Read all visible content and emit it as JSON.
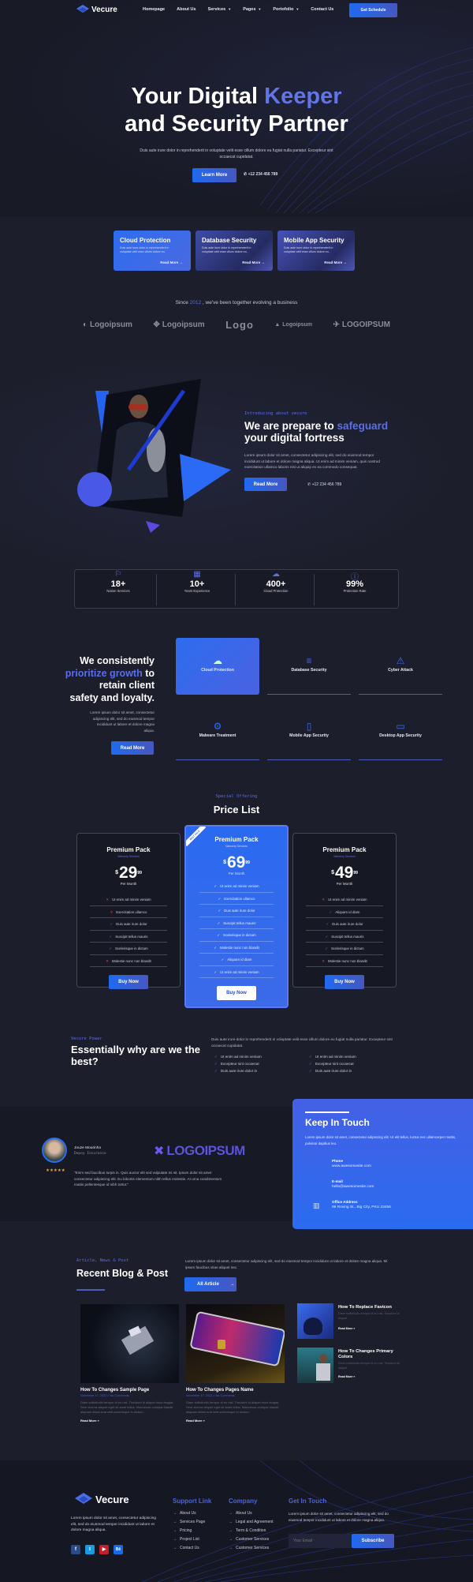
{
  "header": {
    "brand": "Vecure",
    "nav": [
      "Homepage",
      "About Us",
      "Services",
      "Pages",
      "Portofolio",
      "Contact Us"
    ],
    "nav_dropdown": [
      false,
      false,
      true,
      true,
      true,
      false
    ],
    "cta": "Get Schedule"
  },
  "hero": {
    "title_a": "Your Digital ",
    "title_accent": "Keeper",
    "title_b": "and Security Partner",
    "subtitle": "Duis aute irure dolor in reprehenderit in voluptate velit esse cillum dolore eu fugiat nulla pariatur. Excepteur sint occaecat cupidatat.",
    "button": "Learn More",
    "phone": "+12 234 456 789"
  },
  "feature_cards": [
    {
      "title": "Cloud Protection",
      "text": "Duis aute irure dolor in reprehenderit in voluptate velit esse cillum dolore eu.",
      "link": "Read More"
    },
    {
      "title": "Database Security",
      "text": "Duis aute irure dolor in reprehenderit in voluptate velit esse cillum dolore eu.",
      "link": "Read More"
    },
    {
      "title": "Mobile App Security",
      "text": "Duis aute irure dolor in reprehenderit in voluptate velit esse cillum dolore eu.",
      "link": "Read More"
    }
  ],
  "partners": {
    "tagline_a": "Since ",
    "year": "2012",
    "tagline_b": " , we've been together evolving a business",
    "logos": [
      "Logoipsum",
      "Logoipsum",
      "Logo",
      "Logoipsum",
      "LOGOIPSUM"
    ]
  },
  "about": {
    "eyebrow": "Introducing about vecure",
    "title_a": "We are prepare to ",
    "title_accent": "safeguard",
    "title_b": "your digital fortress",
    "text": "Lorem ipsum dolor sit amet, consectetur adipiscing elit, sed do eiusmod tempor incididunt ut labore et dolore magna aliqua. Ut enim ad minim veniam, quis nostrud exercitation ullamco laboris nisi ut aliquip ex ea commodo consequat.",
    "button": "Read More",
    "phone": "+12 234 456 789"
  },
  "stats": [
    {
      "icon": "flag-icon",
      "value": "18+",
      "label": "Nation Services"
    },
    {
      "icon": "calendar-icon",
      "value": "10+",
      "label": "Years Experience"
    },
    {
      "icon": "cloud-icon",
      "value": "400+",
      "label": "Cloud Protection"
    },
    {
      "icon": "alert-icon",
      "value": "99%",
      "label": "Protection Rate"
    }
  ],
  "growth": {
    "title_a": "We consistently",
    "title_accent": "prioritize growth",
    "title_b": " to",
    "title_c": "retain client",
    "title_d": "safety and loyalty.",
    "text": "Lorem ipsum dolor sit amet, consectetur adipiscing elit, sed do eiusmod tempor incididunt ut labore et dolore magna aliqua.",
    "button": "Read More",
    "services": [
      {
        "icon": "☁",
        "label": "Cloud Protection"
      },
      {
        "icon": "≡",
        "label": "Database Security"
      },
      {
        "icon": "⚠",
        "label": "Cyber Attack"
      },
      {
        "icon": "⚙",
        "label": "Malware Treatment"
      },
      {
        "icon": "▯",
        "label": "Mobile App Security"
      },
      {
        "icon": "▭",
        "label": "Desktop App Security"
      }
    ]
  },
  "pricing": {
    "eyebrow": "Special Offering",
    "title": "Price List",
    "ribbon": "BEST SALE",
    "plans": [
      {
        "name": "Premium Pack",
        "sub": "Warranty Services",
        "currency": "$",
        "price": "29",
        "cents": "99",
        "period": "Per Month",
        "button": "Buy Now",
        "features": [
          {
            "t": "Ut enim ad minim veniam",
            "ok": false
          },
          {
            "t": "Exercitation ullamco",
            "ok": false
          },
          {
            "t": "Duis aute irure dolor",
            "ok": true
          },
          {
            "t": "Suscipit tellus mauris",
            "ok": true
          },
          {
            "t": "Scelerisque in dictum",
            "ok": true
          },
          {
            "t": "Molestie nunc non blandit",
            "ok": false
          }
        ]
      },
      {
        "name": "Premium Pack",
        "sub": "Warranty Services",
        "currency": "$",
        "price": "69",
        "cents": "99",
        "period": "Per Month",
        "button": "Buy Now",
        "features": [
          {
            "t": "Ut enim ad minim veniam",
            "ok": true
          },
          {
            "t": "Exercitation ullamco",
            "ok": true
          },
          {
            "t": "Duis aute irure dolor",
            "ok": true
          },
          {
            "t": "Suscipit tellus mauris",
            "ok": true
          },
          {
            "t": "Scelerisque in dictum",
            "ok": true
          },
          {
            "t": "Molestie nunc non blandit",
            "ok": true
          },
          {
            "t": "Aliquam id diam",
            "ok": true
          },
          {
            "t": "Ut enim ad minim veniam",
            "ok": true
          }
        ]
      },
      {
        "name": "Premium Pack",
        "sub": "Warranty Services",
        "currency": "$",
        "price": "49",
        "cents": "99",
        "period": "Per Month",
        "button": "Buy Now",
        "features": [
          {
            "t": "Ut enim ad minim veniam",
            "ok": false
          },
          {
            "t": "Aliquam id diam",
            "ok": true
          },
          {
            "t": "Duis aute irure dolor",
            "ok": true
          },
          {
            "t": "Suscipit tellus mauris",
            "ok": true
          },
          {
            "t": "Scelerisque in dictum",
            "ok": true
          },
          {
            "t": "Molestie nunc non blandit",
            "ok": false
          }
        ]
      }
    ]
  },
  "why": {
    "eyebrow": "Vecure Power",
    "title": "Essentially why are we the best?",
    "text": "Duis aute irure dolor in reprehenderit in voluptate velit esse cillum dolore eu fugiat nulla pariatur. Excepteur sint occaecat cupidatat.",
    "list_a": [
      "Ut enim ad minim veniam",
      "Excepteur sint occaecat",
      "Duis aute irure dolor in"
    ],
    "list_b": [
      "Ut enim ad minim veniam",
      "Excepteur sint occaecat",
      "Duis aute irure dolor in"
    ]
  },
  "testimonial": {
    "name": "Jouze Mourinho",
    "role": "Depoy Insurance",
    "stars": 5,
    "quote": "\"Enim sed faucibus turpis in. Quis auctor elit sed vulputate mi sit. Ipsum dolor sit amet consectetur adipiscing elit. Eu lobortis elementum nibh tellus molestie. At urna condimentum mattis pellentesque id nibh tortor.\"",
    "logo": "LOGOIPSUM"
  },
  "contact": {
    "title": "Keep In Touch",
    "text": "Lorem ipsum dolor sit amet, consectetur adipiscing elit. Ut elit tellus, luctus nec ullamcorper mattis, pulvinar dapibus leo.",
    "items": [
      {
        "label": "Phone",
        "value": "www.awesomesite.com"
      },
      {
        "label": "E-mail",
        "value": "hello@awesomesite.com"
      },
      {
        "label": "Office Address",
        "value": "99 Roving St., Big City, PKU 23456"
      }
    ]
  },
  "blog": {
    "eyebrow": "Article, News & Post",
    "title": "Recent Blog & Post",
    "text": "Lorem ipsum dolor sit amet, consectetur adipiscing elit, sed do eiusmod tempor incididunt ut labore et dolore magna aliqua. Mi ipsum faucibus vitae aliquet nec.",
    "button": "All Article",
    "posts": [
      {
        "title": "How To Changes Sample Page",
        "meta": "November 17, 2022 // No Comments",
        "text": "Diam sollicitudin tempor id eu nisl. Tincidunt id aliquet risus feugiat. Sem viverra aliquet eget sit amet tellus. Maecenas volutpat blandit aliquam etiam erat velit scelerisque in dictum.",
        "link": "Read More »"
      },
      {
        "title": "How To Changes Pages Name",
        "meta": "November 17, 2022 // No Comments",
        "text": "Diam sollicitudin tempor id eu nisl. Tincidunt id aliquet risus feugiat. Sem viverra aliquet eget sit amet tellus. Maecenas volutpat blandit aliquam etiam erat velit scelerisque in dictum.",
        "link": "Read More »"
      }
    ],
    "side_posts": [
      {
        "title": "How To Replace Favicon",
        "text": "Diam sollicitudin tempor id eu nisl. Tincidunt id aliquet",
        "link": "Read More »"
      },
      {
        "title": "How To Changes Primary Colors",
        "text": "Diam sollicitudin tempor id eu nisl. Tincidunt id aliquet",
        "link": "Read More »"
      }
    ]
  },
  "footer": {
    "brand": "Vecure",
    "about": "Lorem ipsum dolor sit amet, consectetur adipiscing elit, sed do eiusmod tempor incididunt ut labore et dolore magna aliqua.",
    "support_title": "Support Link",
    "support": [
      "About Us",
      "Services Page",
      "Pricing",
      "Project List",
      "Contact Us"
    ],
    "company_title": "Company",
    "company": [
      "About Us",
      "Legal and Agreement",
      "Term & Condition",
      "Customer Services",
      "Customer Services"
    ],
    "touch_title": "Get In Touch",
    "touch_text": "Lorem ipsum dolor sit amet, consectetur adipiscing elit, sed do eiusmod tempor incididunt ut labore et dolore magna aliqua.",
    "email_placeholder": "Your Email",
    "subscribe": "Subscribe",
    "social": [
      "facebook-icon",
      "twitter-icon",
      "youtube-icon",
      "behance-icon"
    ]
  }
}
